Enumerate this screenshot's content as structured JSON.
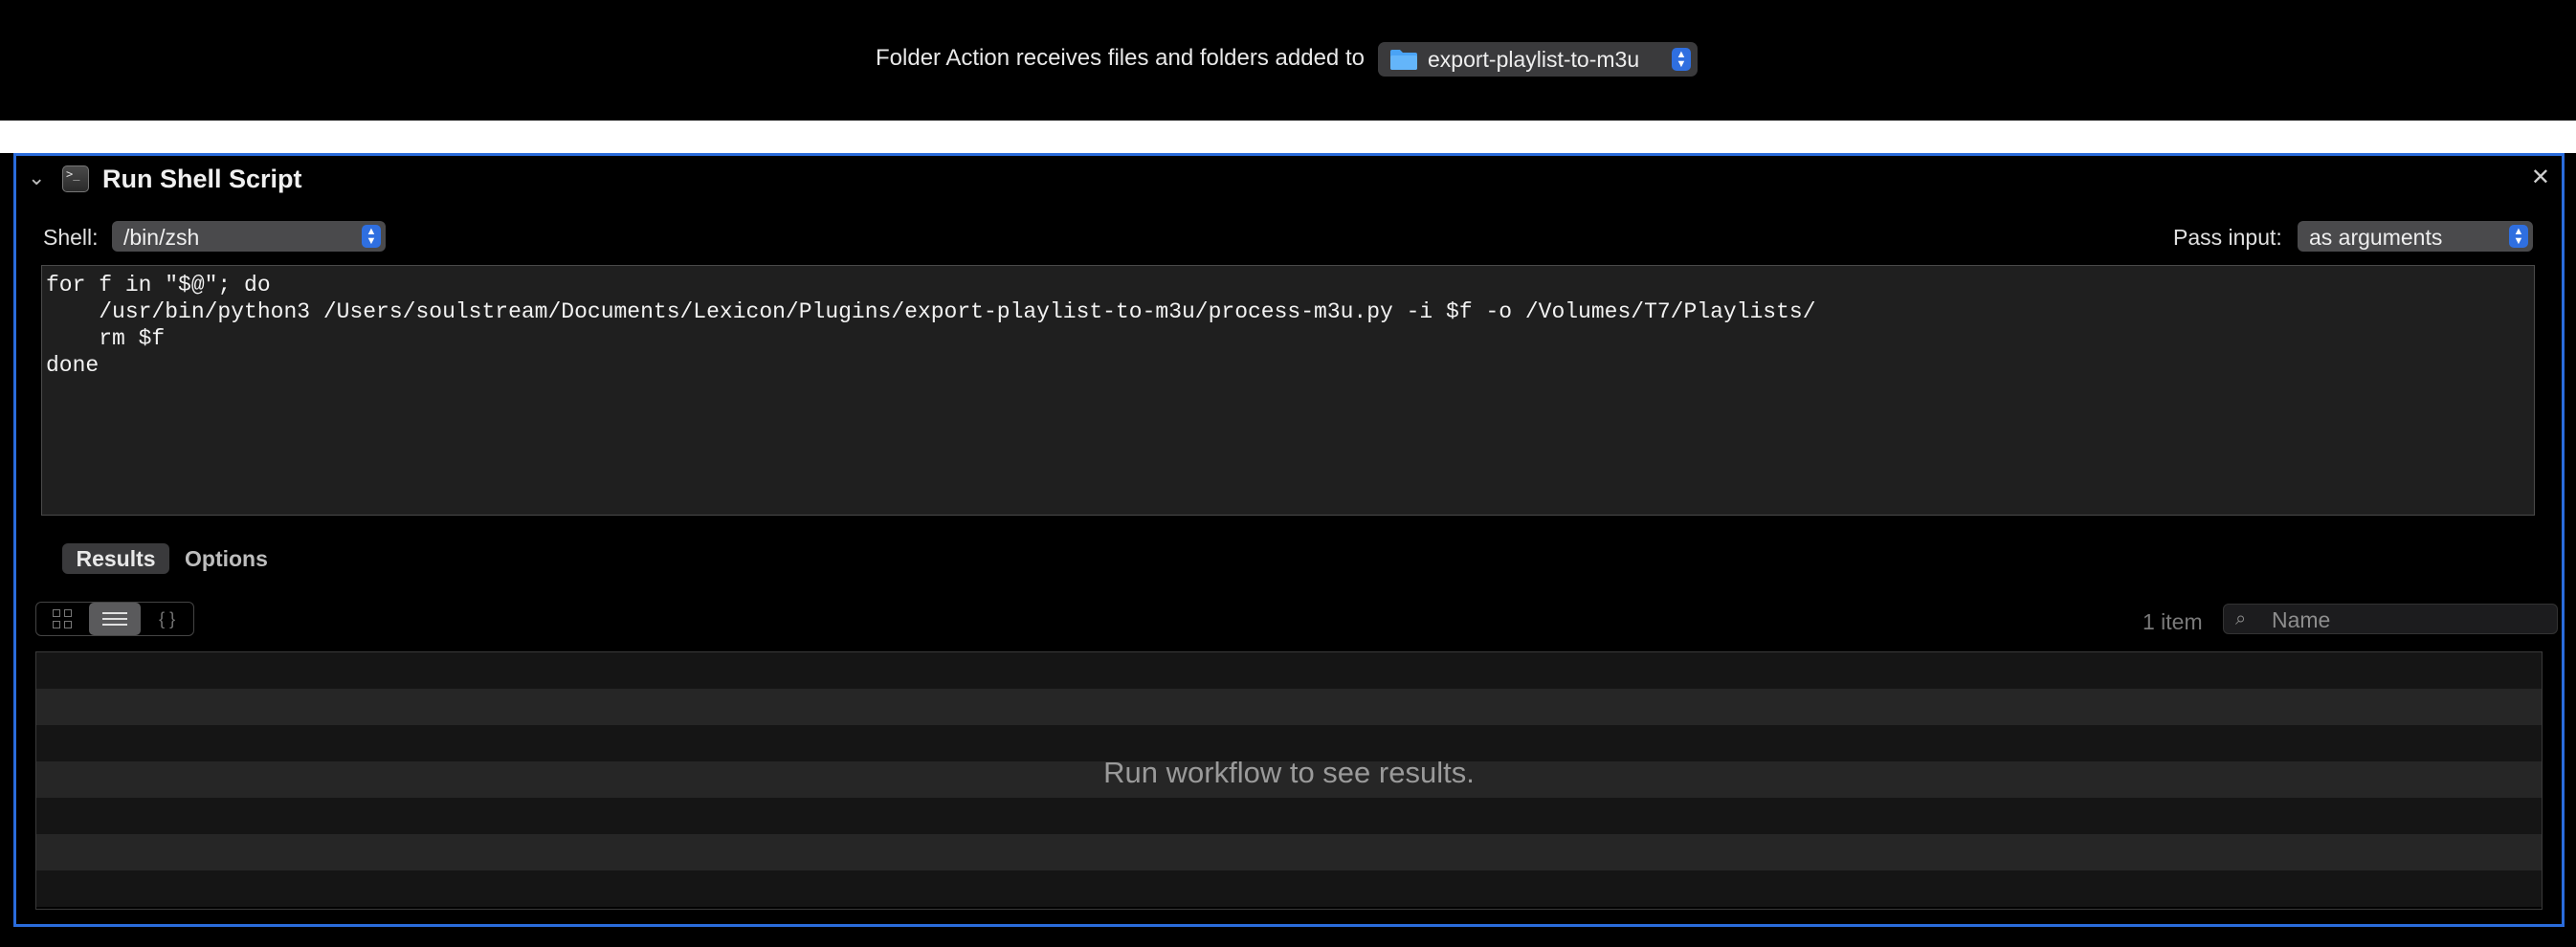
{
  "header": {
    "caption": "Folder Action receives files and folders added to",
    "folder": "export-playlist-to-m3u"
  },
  "action": {
    "title": "Run Shell Script",
    "shell_label": "Shell:",
    "shell_value": "/bin/zsh",
    "pass_label": "Pass input:",
    "pass_value": "as arguments",
    "script": "for f in \"$@\"; do\n    /usr/bin/python3 /Users/soulstream/Documents/Lexicon/Plugins/export-playlist-to-m3u/process-m3u.py -i $f -o /Volumes/T7/Playlists/\n    rm $f\ndone",
    "tabs": {
      "results": "Results",
      "options": "Options"
    },
    "item_count": "1 item",
    "search_placeholder": "Name",
    "empty_message": "Run workflow to see results."
  },
  "colors": {
    "accent": "#2a6cdc",
    "background": "#000000",
    "code_bg": "#1f1f1f"
  },
  "icons": [
    "folder-icon",
    "chevron-down-icon",
    "terminal-icon",
    "close-icon",
    "icon-view-icon",
    "list-view-icon",
    "json-view-icon",
    "search-icon",
    "stepper-icon"
  ]
}
